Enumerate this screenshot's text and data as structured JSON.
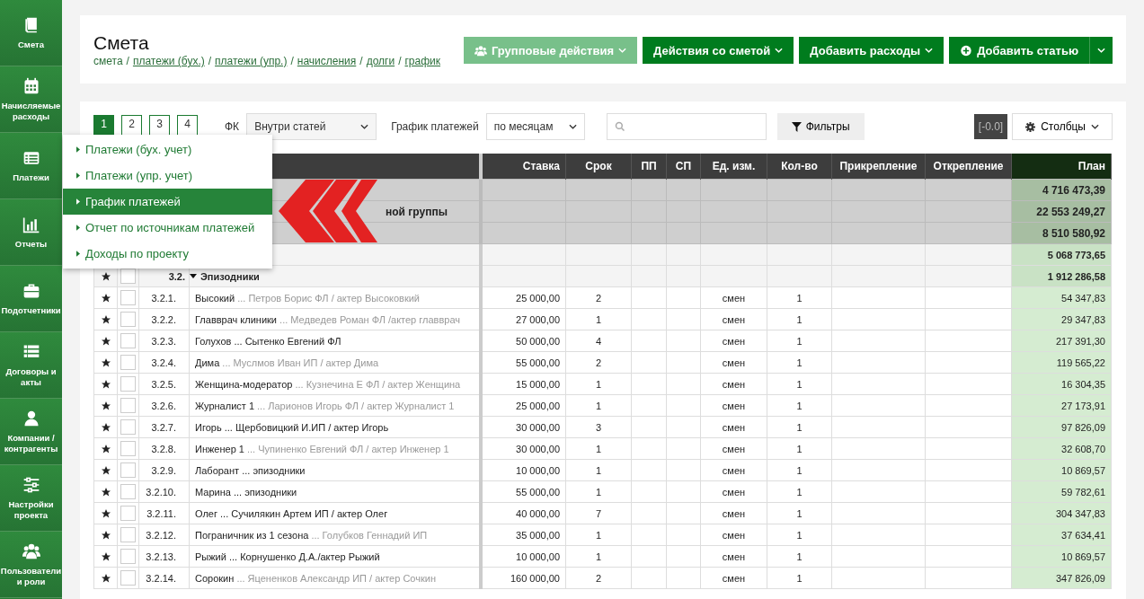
{
  "sidebar": {
    "items": [
      {
        "label": "Смета"
      },
      {
        "label": "Начисляемые расходы"
      },
      {
        "label": "Платежи"
      },
      {
        "label": "Отчеты"
      },
      {
        "label": "Подотчетники"
      },
      {
        "label": "Договоры и акты"
      },
      {
        "label": "Компании / контрагенты"
      },
      {
        "label": "Настройки проекта"
      },
      {
        "label": "Пользователи и роли"
      }
    ]
  },
  "header": {
    "title": "Смета",
    "separator": "/",
    "breadcrumbs": [
      {
        "label": "смета",
        "link": false
      },
      {
        "label": "платежи (бух.)",
        "link": true
      },
      {
        "label": "платежи (упр.)",
        "link": true
      },
      {
        "label": "начисления",
        "link": true
      },
      {
        "label": "долги",
        "link": true
      },
      {
        "label": "график",
        "link": true
      }
    ],
    "buttons": [
      {
        "label": "Групповые действия",
        "disabled": true
      },
      {
        "label": "Действия со сметой",
        "disabled": false
      },
      {
        "label": "Добавить расходы",
        "disabled": false
      },
      {
        "label": "Добавить статью",
        "disabled": false
      }
    ]
  },
  "toolbar": {
    "pages": [
      {
        "label": "1",
        "selected": true
      },
      {
        "label": "2",
        "selected": false
      },
      {
        "label": "3",
        "selected": false
      },
      {
        "label": "4",
        "selected": false
      }
    ],
    "fk_label": "ФК",
    "fk_value": "Внутри статей",
    "schedule_label": "График платежей",
    "schedule_value": "по месяцам",
    "filters": "Фильтры",
    "badge": "[-0.0]",
    "columns_button": "Столбцы"
  },
  "menu": {
    "items": [
      {
        "label": "Платежи (бух. учет)",
        "selected": false
      },
      {
        "label": "Платежи (упр. учет)",
        "selected": false
      },
      {
        "label": "График платежей",
        "selected": true
      },
      {
        "label": "Отчет по источникам платежей",
        "selected": false
      },
      {
        "label": "Доходы по проекту",
        "selected": false
      }
    ]
  },
  "table": {
    "columns": [
      "Ставка",
      "Срок",
      "ПП",
      "СП",
      "Ед. изм.",
      "Кол-во",
      "Прикрепление",
      "Открепление",
      "План"
    ],
    "rows": [
      {
        "kind": "group",
        "plan": "4 716 473,39"
      },
      {
        "kind": "group",
        "label": "ной группы",
        "plan": "22 553 249,27"
      },
      {
        "kind": "group",
        "plan": "8 510 580,92"
      },
      {
        "kind": "subtotal",
        "plan": "5 068 773,65"
      },
      {
        "kind": "section",
        "num": "3.2.",
        "name": "Эпизодники",
        "expanded": true,
        "checked": false,
        "plan": "1 912 286,58"
      },
      {
        "kind": "item",
        "num": "3.2.1.",
        "name": "Высокий",
        "detail": "... Петров Борис ФЛ / актер Высоковкий",
        "detail_dimmed": true,
        "checked": false,
        "rate": "25 000,00",
        "term": "2",
        "unit": "смен",
        "qty": "1",
        "plan": "54 347,83"
      },
      {
        "kind": "item",
        "num": "3.2.2.",
        "name": "Главврач клиники",
        "detail": "... Медведев Роман ФЛ /актер главврач",
        "detail_dimmed": true,
        "checked": false,
        "rate": "27 000,00",
        "term": "1",
        "unit": "смен",
        "qty": "1",
        "plan": "29 347,83"
      },
      {
        "kind": "item",
        "num": "3.2.3.",
        "name": "Голухов",
        "detail": "... Сытенко Евгений ФЛ",
        "detail_dimmed": false,
        "checked": false,
        "rate": "50 000,00",
        "term": "4",
        "unit": "смен",
        "qty": "1",
        "plan": "217 391,30"
      },
      {
        "kind": "item",
        "num": "3.2.4.",
        "name": "Дима",
        "detail": "... Муслмов Иван ИП / актер Дима",
        "detail_dimmed": true,
        "checked": false,
        "rate": "55 000,00",
        "term": "2",
        "unit": "смен",
        "qty": "1",
        "plan": "119 565,22"
      },
      {
        "kind": "item",
        "num": "3.2.5.",
        "name": "Женщина-модератор",
        "detail": "... Кузнечина Е ФЛ / актер Женщина",
        "detail_dimmed": true,
        "checked": false,
        "rate": "15 000,00",
        "term": "1",
        "unit": "смен",
        "qty": "1",
        "plan": "16 304,35"
      },
      {
        "kind": "item",
        "num": "3.2.6.",
        "name": "Журналист 1",
        "detail": "... Ларионов Игорь ФЛ / актер Журналист 1",
        "detail_dimmed": true,
        "checked": false,
        "rate": "25 000,00",
        "term": "1",
        "unit": "смен",
        "qty": "1",
        "plan": "27 173,91"
      },
      {
        "kind": "item",
        "num": "3.2.7.",
        "name": "Игорь",
        "detail": "... Щербовицкий И.ИП / актер Игорь",
        "detail_dimmed": false,
        "checked": false,
        "rate": "30 000,00",
        "term": "3",
        "unit": "смен",
        "qty": "1",
        "plan": "97 826,09"
      },
      {
        "kind": "item",
        "num": "3.2.8.",
        "name": "Инженер 1",
        "detail": "... Чупиненко Евгений ФЛ / актер Инженер 1",
        "detail_dimmed": true,
        "checked": false,
        "rate": "30 000,00",
        "term": "1",
        "unit": "смен",
        "qty": "1",
        "plan": "32 608,70"
      },
      {
        "kind": "item",
        "num": "3.2.9.",
        "name": "Лаборант",
        "detail": "... эпизодники",
        "detail_dimmed": false,
        "checked": false,
        "rate": "10 000,00",
        "term": "1",
        "unit": "смен",
        "qty": "1",
        "plan": "10 869,57"
      },
      {
        "kind": "item",
        "num": "3.2.10.",
        "name": "Марина",
        "detail": "... эпизодники",
        "detail_dimmed": false,
        "checked": false,
        "rate": "55 000,00",
        "term": "1",
        "unit": "смен",
        "qty": "1",
        "plan": "59 782,61"
      },
      {
        "kind": "item",
        "num": "3.2.11.",
        "name": "Олег",
        "detail": "... Сучилякин Артем ИП / актер Олег",
        "detail_dimmed": false,
        "checked": false,
        "rate": "40 000,00",
        "term": "7",
        "unit": "смен",
        "qty": "1",
        "plan": "304 347,83"
      },
      {
        "kind": "item",
        "num": "3.2.12.",
        "name": "Пограничник из 1 сезона",
        "detail": "... Голубков Геннадий ИП",
        "detail_dimmed": true,
        "checked": false,
        "rate": "35 000,00",
        "term": "1",
        "unit": "смен",
        "qty": "1",
        "plan": "37 634,41"
      },
      {
        "kind": "item",
        "num": "3.2.13.",
        "name": "Рыжий",
        "detail": "... Корнушенко Д.А./актер Рыжий",
        "detail_dimmed": false,
        "checked": false,
        "rate": "10 000,00",
        "term": "1",
        "unit": "смен",
        "qty": "1",
        "plan": "10 869,57"
      },
      {
        "kind": "item",
        "num": "3.2.14.",
        "name": "Сорокин",
        "detail": "... Яцененков Александр ИП / актер Сочкин",
        "detail_dimmed": true,
        "checked": false,
        "rate": "160 000,00",
        "term": "2",
        "unit": "смен",
        "qty": "1",
        "plan": "347 826,09"
      }
    ]
  }
}
